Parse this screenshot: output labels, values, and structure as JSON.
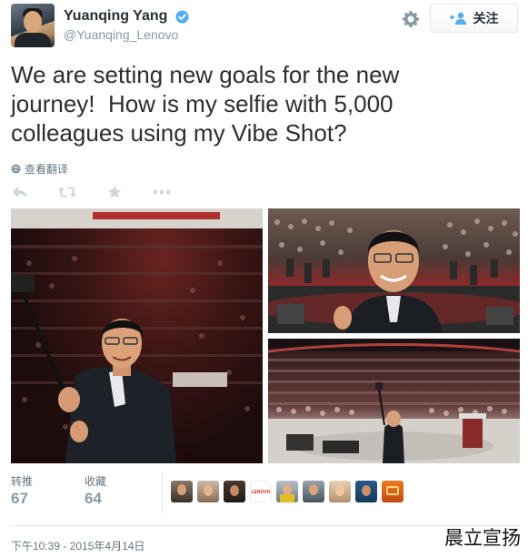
{
  "user": {
    "fullname": "Yuanqing Yang",
    "handle": "@Yuanqing_Lenovo",
    "verified": true
  },
  "header": {
    "follow_label": "关注"
  },
  "tweet": {
    "text": "We are setting new goals for the new\njourney!  How is my selfie with 5,000\ncolleagues using my Vibe Shot?",
    "translate_label": "查看翻译"
  },
  "stats": {
    "retweets_label": "转推",
    "retweets_count": "67",
    "favorites_label": "收藏",
    "favorites_count": "64"
  },
  "likers_logo_text": "LENOVO",
  "timestamp": "下午10:39 - 2015年4月14日",
  "watermark": "晨立宣扬",
  "colors": {
    "text": "#292f33",
    "muted": "#8899a6",
    "verified_blue": "#55acee",
    "border": "#e1e8ed"
  },
  "icons": {
    "settings": "gear-icon",
    "follow": "add-person-icon",
    "verified": "verified-badge-icon",
    "globe": "globe-icon",
    "reply": "reply-icon",
    "retweet": "retweet-icon",
    "favorite": "star-icon",
    "more": "more-icon"
  }
}
